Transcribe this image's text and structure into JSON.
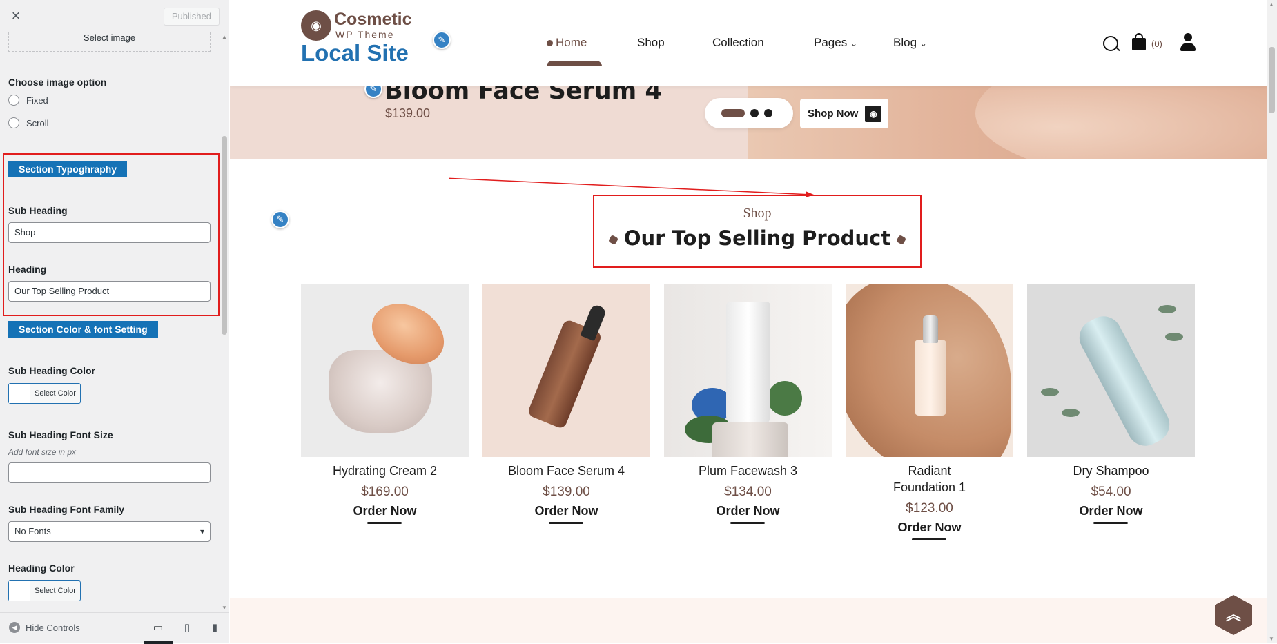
{
  "customizer": {
    "close_label": "×",
    "published_label": "Published",
    "select_image_label": "Select image",
    "image_option_label": "Choose image option",
    "image_options": [
      "Fixed",
      "Scroll"
    ],
    "section_typography_label": "Section Typoghraphy",
    "sub_heading_label": "Sub Heading",
    "sub_heading_value": "Shop",
    "heading_label": "Heading",
    "heading_value": "Our Top Selling Product",
    "section_color_label": "Section Color & font Setting",
    "sub_heading_color_label": "Sub Heading Color",
    "select_color_label": "Select Color",
    "sub_heading_font_size_label": "Sub Heading Font Size",
    "font_size_hint": "Add font size in px",
    "sub_heading_font_size_value": "",
    "sub_heading_font_family_label": "Sub Heading Font Family",
    "font_family_value": "No Fonts",
    "heading_color_label": "Heading Color",
    "hide_controls_label": "Hide Controls",
    "devices": [
      "desktop-icon",
      "tablet-icon",
      "mobile-icon"
    ]
  },
  "site": {
    "logo_name": "Cosmetic",
    "logo_tagline": "WP Theme",
    "site_title": "Local Site",
    "nav": [
      "Home",
      "Shop",
      "Collection",
      "Pages",
      "Blog"
    ],
    "nav_dropdown_marker": "⌄",
    "cart_count": "(0)",
    "accent_color": "#6e4f46",
    "highlight_color": "#e11d1d"
  },
  "hero": {
    "title": "Bloom Face Serum 4",
    "price": "$139.00",
    "shop_now": "Shop Now"
  },
  "section": {
    "sub_heading": "Shop",
    "heading": "Our Top Selling Product"
  },
  "products": [
    {
      "name": "Hydrating Cream 2",
      "price": "$169.00",
      "action": "Order Now"
    },
    {
      "name": "Bloom Face Serum 4",
      "price": "$139.00",
      "action": "Order Now"
    },
    {
      "name": "Plum Facewash 3",
      "price": "$134.00",
      "action": "Order Now"
    },
    {
      "name": "Radiant Foundation 1",
      "price": "$123.00",
      "action": "Order Now"
    },
    {
      "name": "Dry Shampoo",
      "price": "$54.00",
      "action": "Order Now"
    }
  ],
  "scroll_top_icon": "double-chevron-up-icon"
}
